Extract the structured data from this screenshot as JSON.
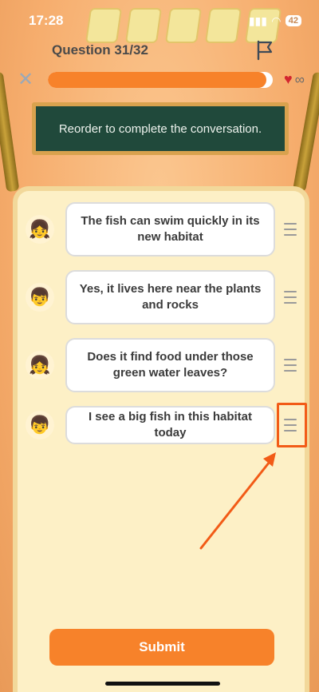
{
  "status_bar": {
    "time": "17:28",
    "battery": "42"
  },
  "header": {
    "title": "Question 31/32"
  },
  "progress": {
    "value": 0.97
  },
  "lives": {
    "value": "∞"
  },
  "board": {
    "instruction": "Reorder to complete the conversation."
  },
  "messages": [
    {
      "text": "The fish can swim quickly in its new habitat",
      "avatar": "girl-avatar"
    },
    {
      "text": "Yes, it lives here near the plants and rocks",
      "avatar": "boy-avatar"
    },
    {
      "text": "Does it find food under those green water leaves?",
      "avatar": "girl-avatar"
    },
    {
      "text": "I see a big fish in this habitat today",
      "avatar": "boy-avatar"
    }
  ],
  "submit": {
    "label": "Submit"
  },
  "colors": {
    "accent": "#f7822a",
    "board": "#20493b",
    "highlight": "#f25b17"
  }
}
